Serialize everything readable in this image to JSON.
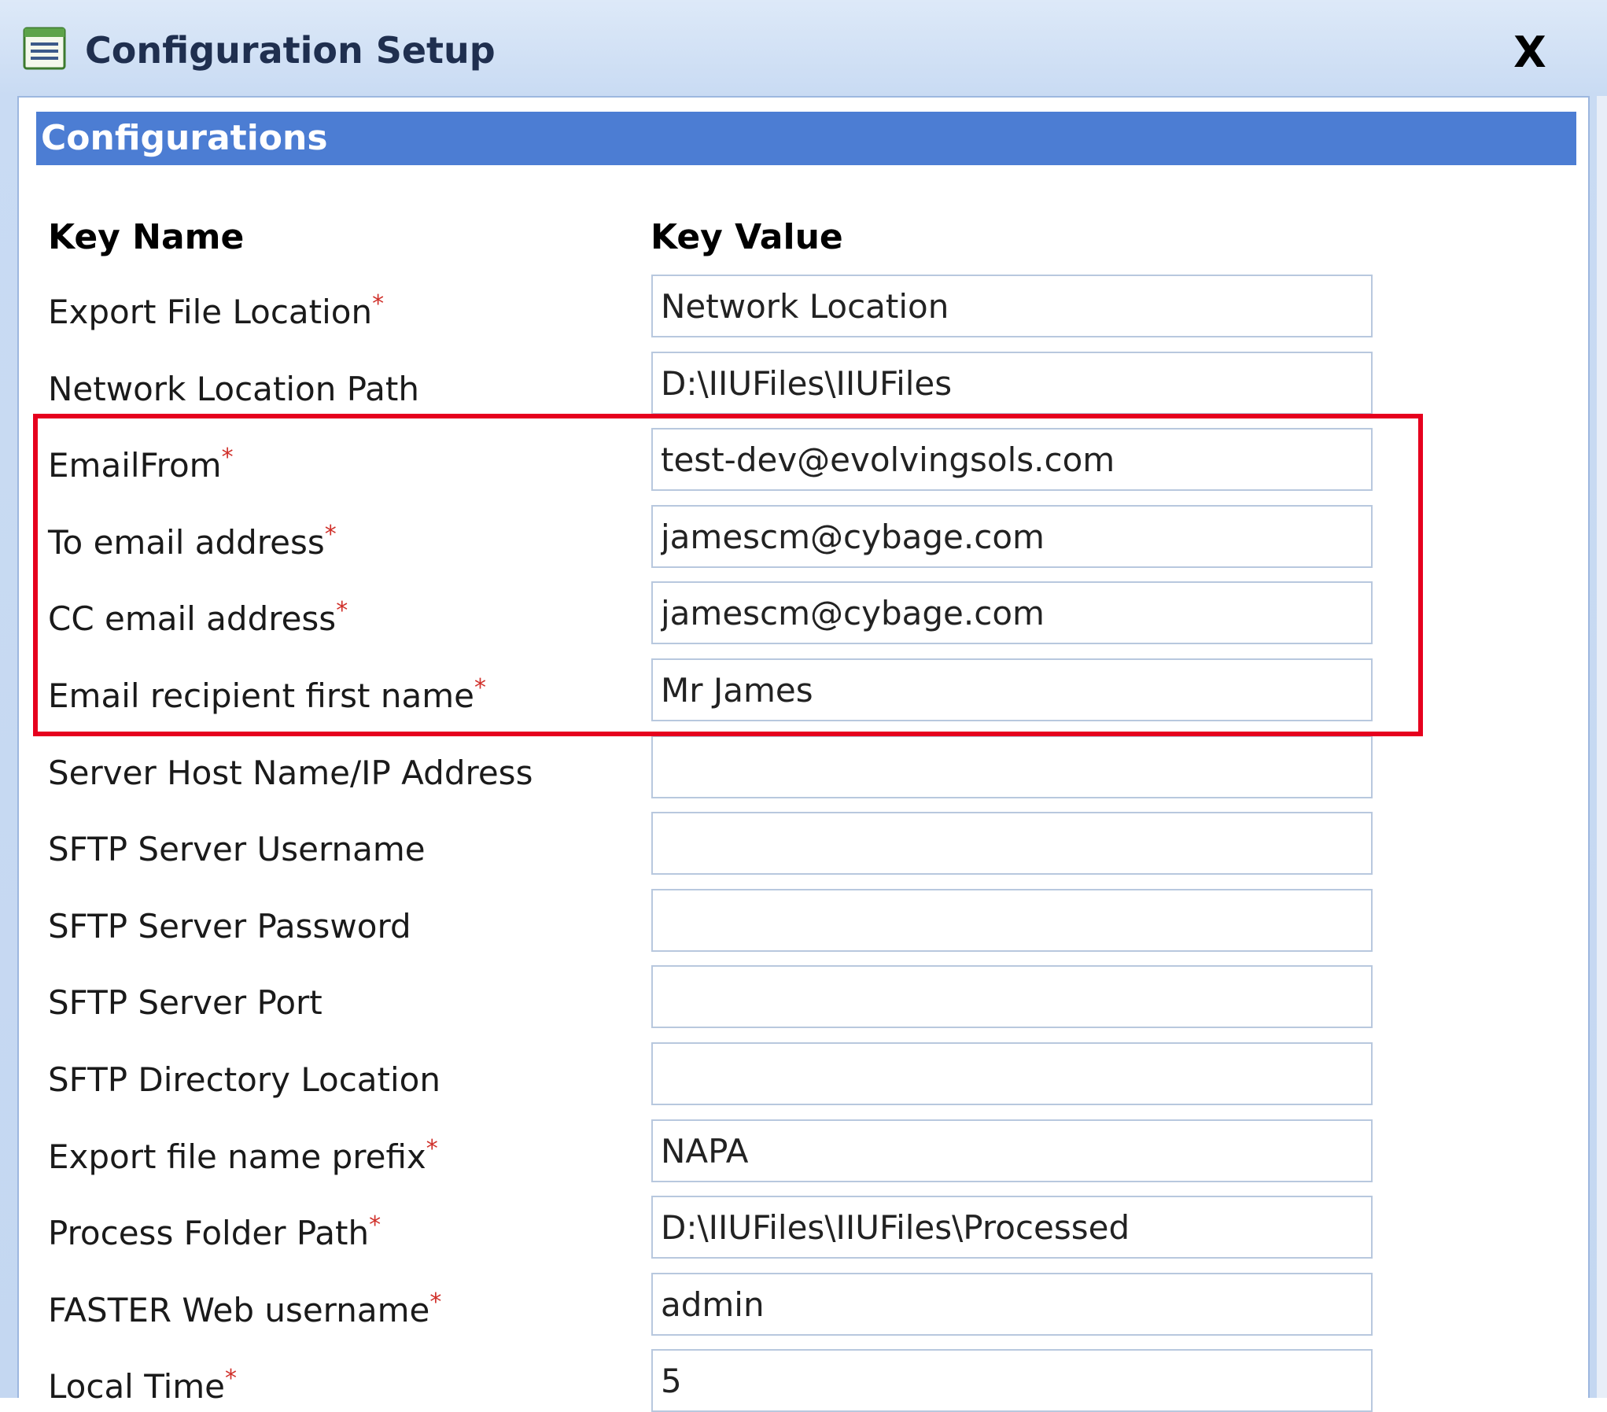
{
  "window": {
    "title": "Configuration Setup",
    "close_label": "X"
  },
  "section": {
    "title": "Configurations"
  },
  "columns": {
    "key_name": "Key Name",
    "key_value": "Key Value"
  },
  "required_marker": "*",
  "rows": [
    {
      "label": "Export File Location",
      "required": true,
      "value": "Network Location"
    },
    {
      "label": "Network Location Path",
      "required": false,
      "value": "D:\\IIUFiles\\IIUFiles"
    },
    {
      "label": "EmailFrom",
      "required": true,
      "value": "test-dev@evolvingsols.com"
    },
    {
      "label": "To email address",
      "required": true,
      "value": "jamescm@cybage.com"
    },
    {
      "label": "CC email address",
      "required": true,
      "value": "jamescm@cybage.com"
    },
    {
      "label": "Email recipient first name",
      "required": true,
      "value": "Mr James"
    },
    {
      "label": "Server Host Name/IP Address",
      "required": false,
      "value": ""
    },
    {
      "label": "SFTP Server Username",
      "required": false,
      "value": ""
    },
    {
      "label": "SFTP Server Password",
      "required": false,
      "value": ""
    },
    {
      "label": "SFTP Server Port",
      "required": false,
      "value": ""
    },
    {
      "label": "SFTP Directory Location",
      "required": false,
      "value": ""
    },
    {
      "label": "Export file name prefix",
      "required": true,
      "value": "NAPA"
    },
    {
      "label": "Process Folder Path",
      "required": true,
      "value": "D:\\IIUFiles\\IIUFiles\\Processed"
    },
    {
      "label": "FASTER Web username",
      "required": true,
      "value": "admin"
    },
    {
      "label": "Local Time",
      "required": true,
      "value": "5"
    }
  ],
  "colors": {
    "section_header_bg": "#4c7dd3",
    "highlight_border": "#e6001e",
    "required_marker": "#d0302a"
  }
}
